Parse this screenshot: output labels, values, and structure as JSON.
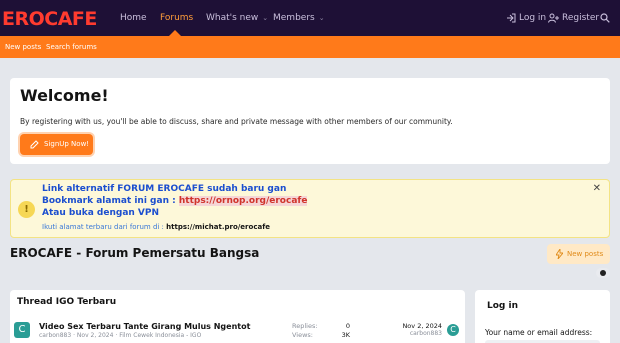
{
  "header": {
    "logo_text": "EROCAFE",
    "nav": [
      {
        "label": "Home"
      },
      {
        "label": "Forums"
      },
      {
        "label": "What's new"
      },
      {
        "label": "Members"
      }
    ],
    "login_label": "Log in",
    "register_label": "Register"
  },
  "subnav": {
    "new_posts": "New posts",
    "search_forums": "Search forums"
  },
  "welcome": {
    "title": "Welcome!",
    "text": "By registering with us, you'll be able to discuss, share and private message with other members of our community.",
    "signup_label": "SignUp Now!"
  },
  "notice": {
    "line1": "Link alternatif FORUM EROCAFE sudah baru gan",
    "line2_prefix": "Bookmark alamat ini gan :",
    "line2_link": "https://ornop.org/erocafe",
    "line3": "Atau buka dengan VPN",
    "small_prefix": "Ikuti alamat terbaru dari forum di :",
    "small_link": "https://michat.pro/erocafe"
  },
  "page": {
    "title": "EROCAFE - Forum Pemersatu Bangsa",
    "new_posts_button": "New posts"
  },
  "thread_widget": {
    "title": "Thread IGO Terbaru",
    "threads": [
      {
        "avatar_letter": "C",
        "title": "Video Sex Terbaru Tante Girang Mulus Ngentot",
        "author": "carbon883",
        "date": "Nov 2, 2024",
        "forum": "Film Cewek Indonesia - IGO",
        "replies_label": "Replies:",
        "replies": "0",
        "views_label": "Views:",
        "views": "3K",
        "last_date": "Nov 2, 2024",
        "last_user": "carbon883",
        "last_avatar_letter": "C"
      }
    ]
  },
  "login_widget": {
    "title": "Log in",
    "field_label": "Your name or email address:"
  },
  "colors": {
    "nav_bg": "#1e1036",
    "accent": "#ff7a1a",
    "notice_bg": "#fdf8d9",
    "link_blue": "#1b4ecf"
  }
}
